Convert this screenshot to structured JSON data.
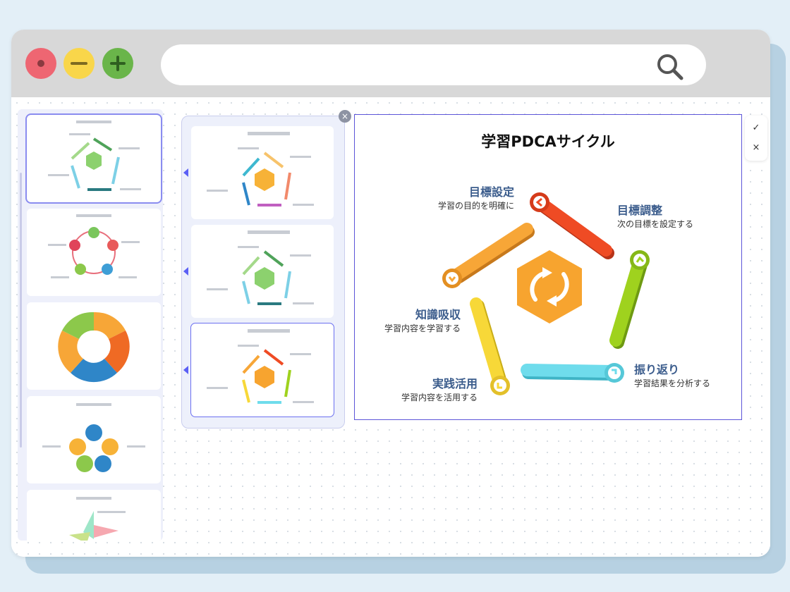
{
  "window": {
    "search": {
      "value": "",
      "placeholder": ""
    }
  },
  "slide": {
    "title": "学習PDCAサイクル",
    "steps": [
      {
        "title": "目標設定",
        "desc": "学習の目的を明確に",
        "color": "#ef4b24"
      },
      {
        "title": "目標調整",
        "desc": "次の目標を設定する",
        "color": "#9fd21e"
      },
      {
        "title": "振り返り",
        "desc": "学習結果を分析する",
        "color": "#6fdcec"
      },
      {
        "title": "実践活用",
        "desc": "学習内容を活用する",
        "color": "#f7d838"
      },
      {
        "title": "知識吸収",
        "desc": "学習内容を学習する",
        "color": "#f7a637"
      }
    ],
    "center_color": "#f7a42f",
    "center_icon": "cycle-arrows-icon"
  },
  "actions": {
    "confirm": "✓",
    "close": "×"
  },
  "close_badge": "×",
  "colors": {
    "accent": "#5c55d8",
    "titlebar": "#d8d8d8",
    "background": "#e3eff7"
  }
}
